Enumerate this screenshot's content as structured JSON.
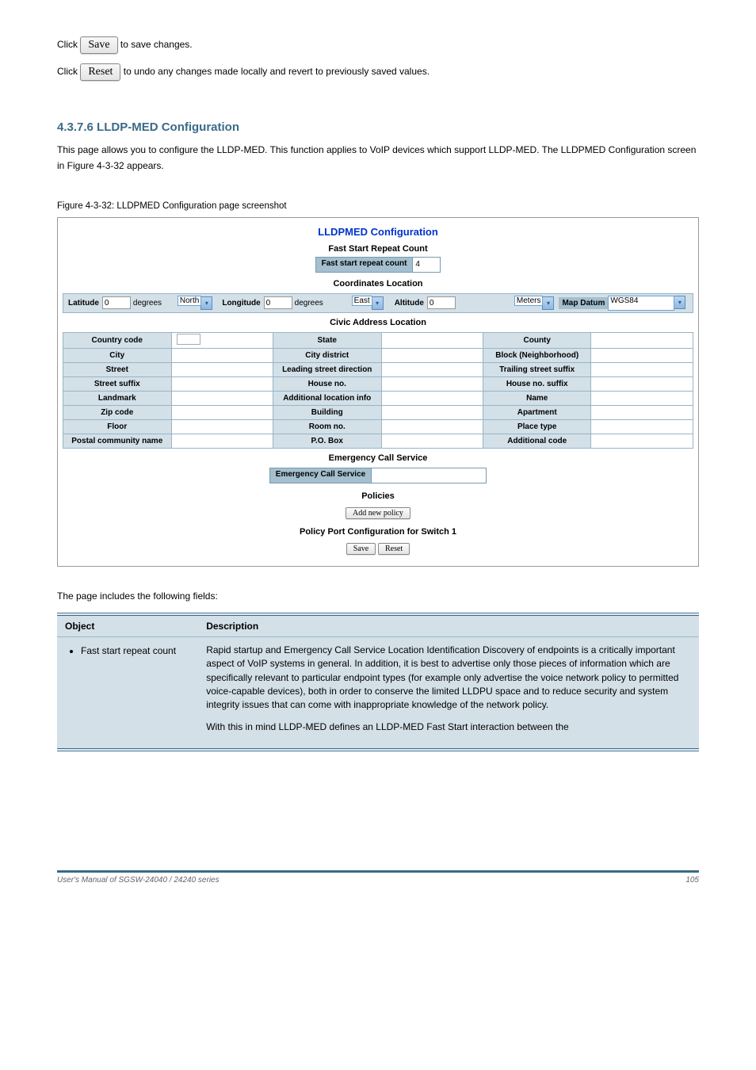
{
  "intro": {
    "line1_pre": "Click ",
    "save_btn": "Save",
    "line1_post": " to save changes.",
    "line2_pre": "Click ",
    "reset_btn": "Reset",
    "line2_post": " to undo any changes made locally and revert to previously saved values."
  },
  "section_heading": "4.3.7.6 LLDP-MED Configuration",
  "section_text": "This page allows you to configure the LLDP-MED. This function applies to VoIP devices which support LLDP-MED. The LLDPMED Configuration screen in Figure 4-3-32 appears.",
  "figure_caption": "Figure 4-3-32: LLDPMED Configuration page screenshot",
  "screenshot": {
    "title": "LLDPMED Configuration",
    "fast_start": {
      "heading": "Fast Start Repeat Count",
      "label": "Fast start repeat count",
      "value": "4"
    },
    "coordinates": {
      "heading": "Coordinates Location",
      "latitude_label": "Latitude",
      "latitude_value": "0",
      "degrees1": "degrees",
      "lat_dir": "North",
      "longitude_label": "Longitude",
      "longitude_value": "0",
      "degrees2": "degrees",
      "lon_dir": "East",
      "altitude_label": "Altitude",
      "altitude_value": "0",
      "alt_unit": "Meters",
      "map_datum_label": "Map Datum",
      "map_datum_value": "WGS84"
    },
    "civic": {
      "heading": "Civic Address Location",
      "rows": [
        [
          "Country code",
          "State",
          "County"
        ],
        [
          "City",
          "City district",
          "Block (Neighborhood)"
        ],
        [
          "Street",
          "Leading street direction",
          "Trailing street suffix"
        ],
        [
          "Street suffix",
          "House no.",
          "House no. suffix"
        ],
        [
          "Landmark",
          "Additional location info",
          "Name"
        ],
        [
          "Zip code",
          "Building",
          "Apartment"
        ],
        [
          "Floor",
          "Room no.",
          "Place type"
        ],
        [
          "Postal community name",
          "P.O. Box",
          "Additional code"
        ]
      ]
    },
    "ecs": {
      "heading": "Emergency Call Service",
      "label": "Emergency Call Service"
    },
    "policies": {
      "heading": "Policies",
      "add_btn": "Add new policy",
      "port_heading": "Policy Port Configuration for Switch 1",
      "save_btn": "Save",
      "reset_btn": "Reset"
    }
  },
  "desc_intro": "The page includes the following fields:",
  "table": {
    "head_obj": "Object",
    "head_desc": "Description",
    "obj1": "Fast start repeat count",
    "desc1_p1": "Rapid startup and Emergency Call Service Location Identification Discovery of endpoints is a critically important aspect of VoIP systems in general. In addition, it is best to advertise only those pieces of information which are specifically relevant to particular endpoint types (for example only advertise the voice network policy to permitted voice-capable devices), both in order to conserve the limited LLDPU space and to reduce security and system integrity issues that can come with inappropriate knowledge of the network policy.",
    "desc1_p2": "With this in mind LLDP-MED defines an LLDP-MED Fast Start interaction between the"
  },
  "footer": {
    "left": "User's Manual of SGSW-24040 / 24240 series",
    "right": "105"
  }
}
